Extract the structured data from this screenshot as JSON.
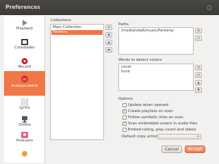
{
  "window": {
    "title": "Preferences",
    "close_glyph": "×"
  },
  "sidebar": {
    "items": [
      {
        "label": "Playback",
        "icon": "play-icon"
      },
      {
        "label": "Crossfader",
        "icon": "crossfader-icon"
      },
      {
        "label": "Record",
        "icon": "record-icon"
      },
      {
        "label": "Audioscrobble",
        "icon": "scrobbler-icon"
      },
      {
        "label": "Lyrics",
        "icon": "lyrics-icon"
      },
      {
        "label": "Online",
        "icon": "online-icon"
      },
      {
        "label": "Podcasts",
        "icon": "podcast-icon"
      }
    ],
    "active_index": 3
  },
  "collections": {
    "title": "Collections",
    "items": [
      "Main Collection",
      "Pantera"
    ],
    "selected_index": 1,
    "buttons": [
      "add-icon",
      "edit-icon",
      "up-icon",
      "remove-icon"
    ]
  },
  "paths": {
    "title": "Paths",
    "items": [
      "/media/sda6/music/Pantera/"
    ]
  },
  "words": {
    "title": "Words to detect covers",
    "items": [
      "cover",
      "front"
    ]
  },
  "options": {
    "title": "Options",
    "checks": [
      {
        "label": "Update when opened",
        "checked": false
      },
      {
        "label": "Create playlists on scan",
        "checked": true
      },
      {
        "label": "Follow symbolic links on scan",
        "checked": false
      },
      {
        "label": "Scan embedded covers in audio files",
        "checked": true
      },
      {
        "label": "Embed rating, play count and labels",
        "checked": false
      }
    ],
    "copy_action_label": "Default copy action"
  },
  "buttons": {
    "cancel": "Cancel",
    "accept": "Accept"
  },
  "colors": {
    "accent": "#f07746",
    "titlebar": "#3c3b37"
  }
}
